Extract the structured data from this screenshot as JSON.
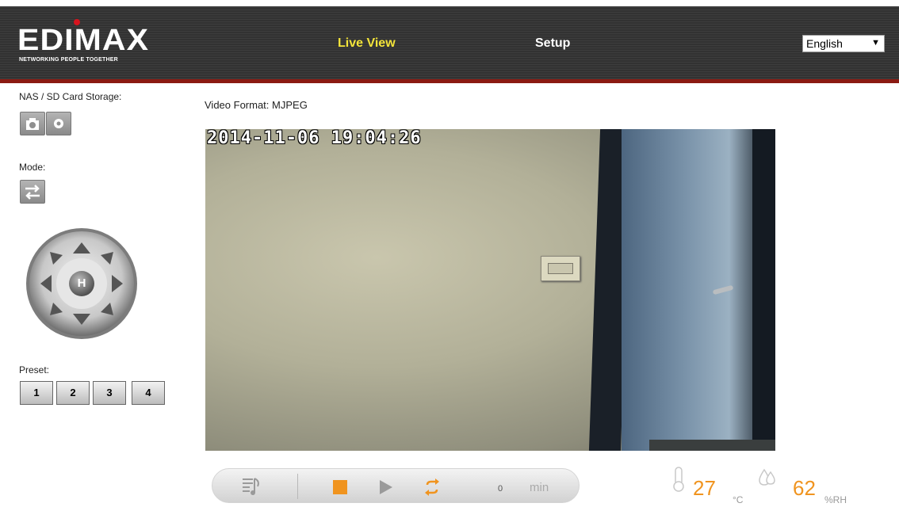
{
  "header": {
    "logo_text": "EDIMAX",
    "logo_tagline": "NETWORKING PEOPLE TOGETHER",
    "nav": {
      "live_view": "Live View",
      "setup": "Setup"
    },
    "language": {
      "selected": "English",
      "arrow": "▼"
    }
  },
  "sidebar": {
    "storage_label": "NAS / SD Card Storage:",
    "mode_label": "Mode:",
    "ptz_home": "H",
    "preset_label": "Preset:",
    "presets": [
      "1",
      "2",
      "3",
      "4"
    ]
  },
  "video": {
    "format_label": "Video Format: MJPEG",
    "timestamp": "2014-11-06 19:04:26"
  },
  "controls": {
    "timer_value": "0",
    "timer_unit": "min"
  },
  "sensors": {
    "temperature_value": "27",
    "temperature_unit": "°C",
    "humidity_value": "62",
    "humidity_unit": "%RH"
  },
  "colors": {
    "accent": "#f0941f",
    "nav_active": "#f3e43a",
    "header_border": "#8b1a12"
  }
}
